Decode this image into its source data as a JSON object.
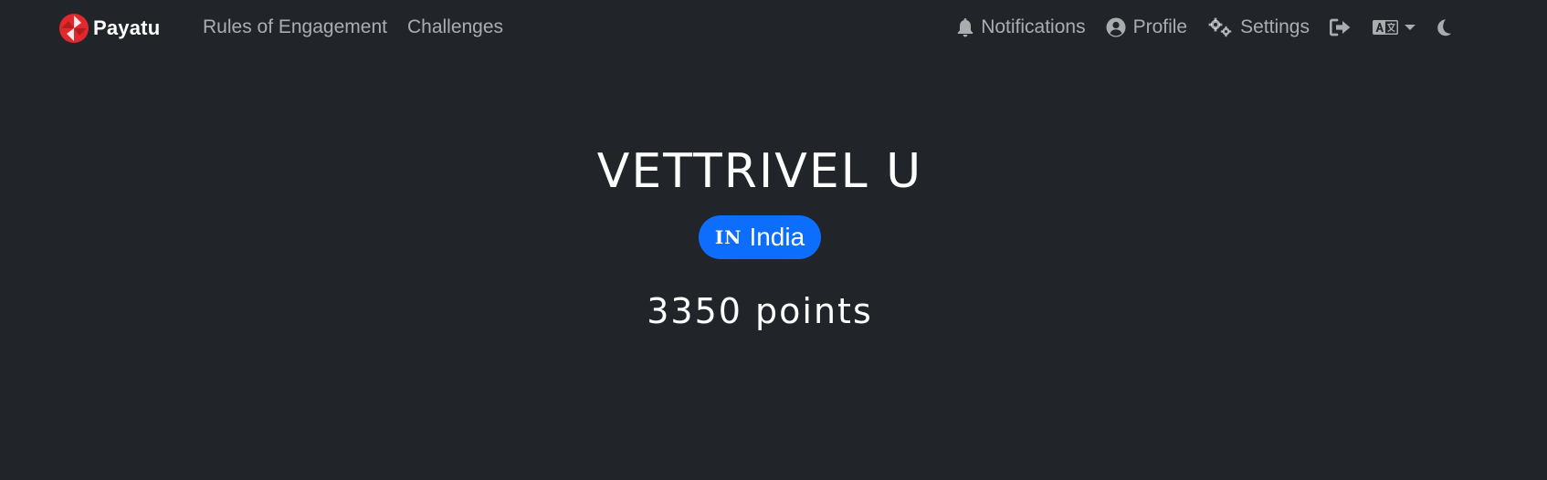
{
  "navbar": {
    "brand": {
      "name": "Payatu",
      "logo_icon": "payatu-logo-icon",
      "logo_colors": [
        "#e0282e",
        "#b71c1c",
        "#ffffff"
      ]
    },
    "left_links": [
      {
        "label": "Rules of Engagement"
      },
      {
        "label": "Challenges"
      }
    ],
    "right_items": [
      {
        "label": "Notifications",
        "icon": "bell-icon"
      },
      {
        "label": "Profile",
        "icon": "user-circle-icon"
      },
      {
        "label": "Settings",
        "icon": "cogs-icon"
      }
    ],
    "logout_icon": "sign-out-icon",
    "language_icon": "language-icon",
    "theme_icon": "moon-icon"
  },
  "profile": {
    "name": "VETTRIVEL U",
    "country": {
      "code": "IN",
      "name": "India",
      "badge_color": "#0d6efd"
    },
    "points_value": "3350",
    "points_label": "points"
  },
  "colors": {
    "background": "#212529",
    "nav_text": "rgba(255,255,255,0.62)",
    "accent": "#0d6efd"
  }
}
